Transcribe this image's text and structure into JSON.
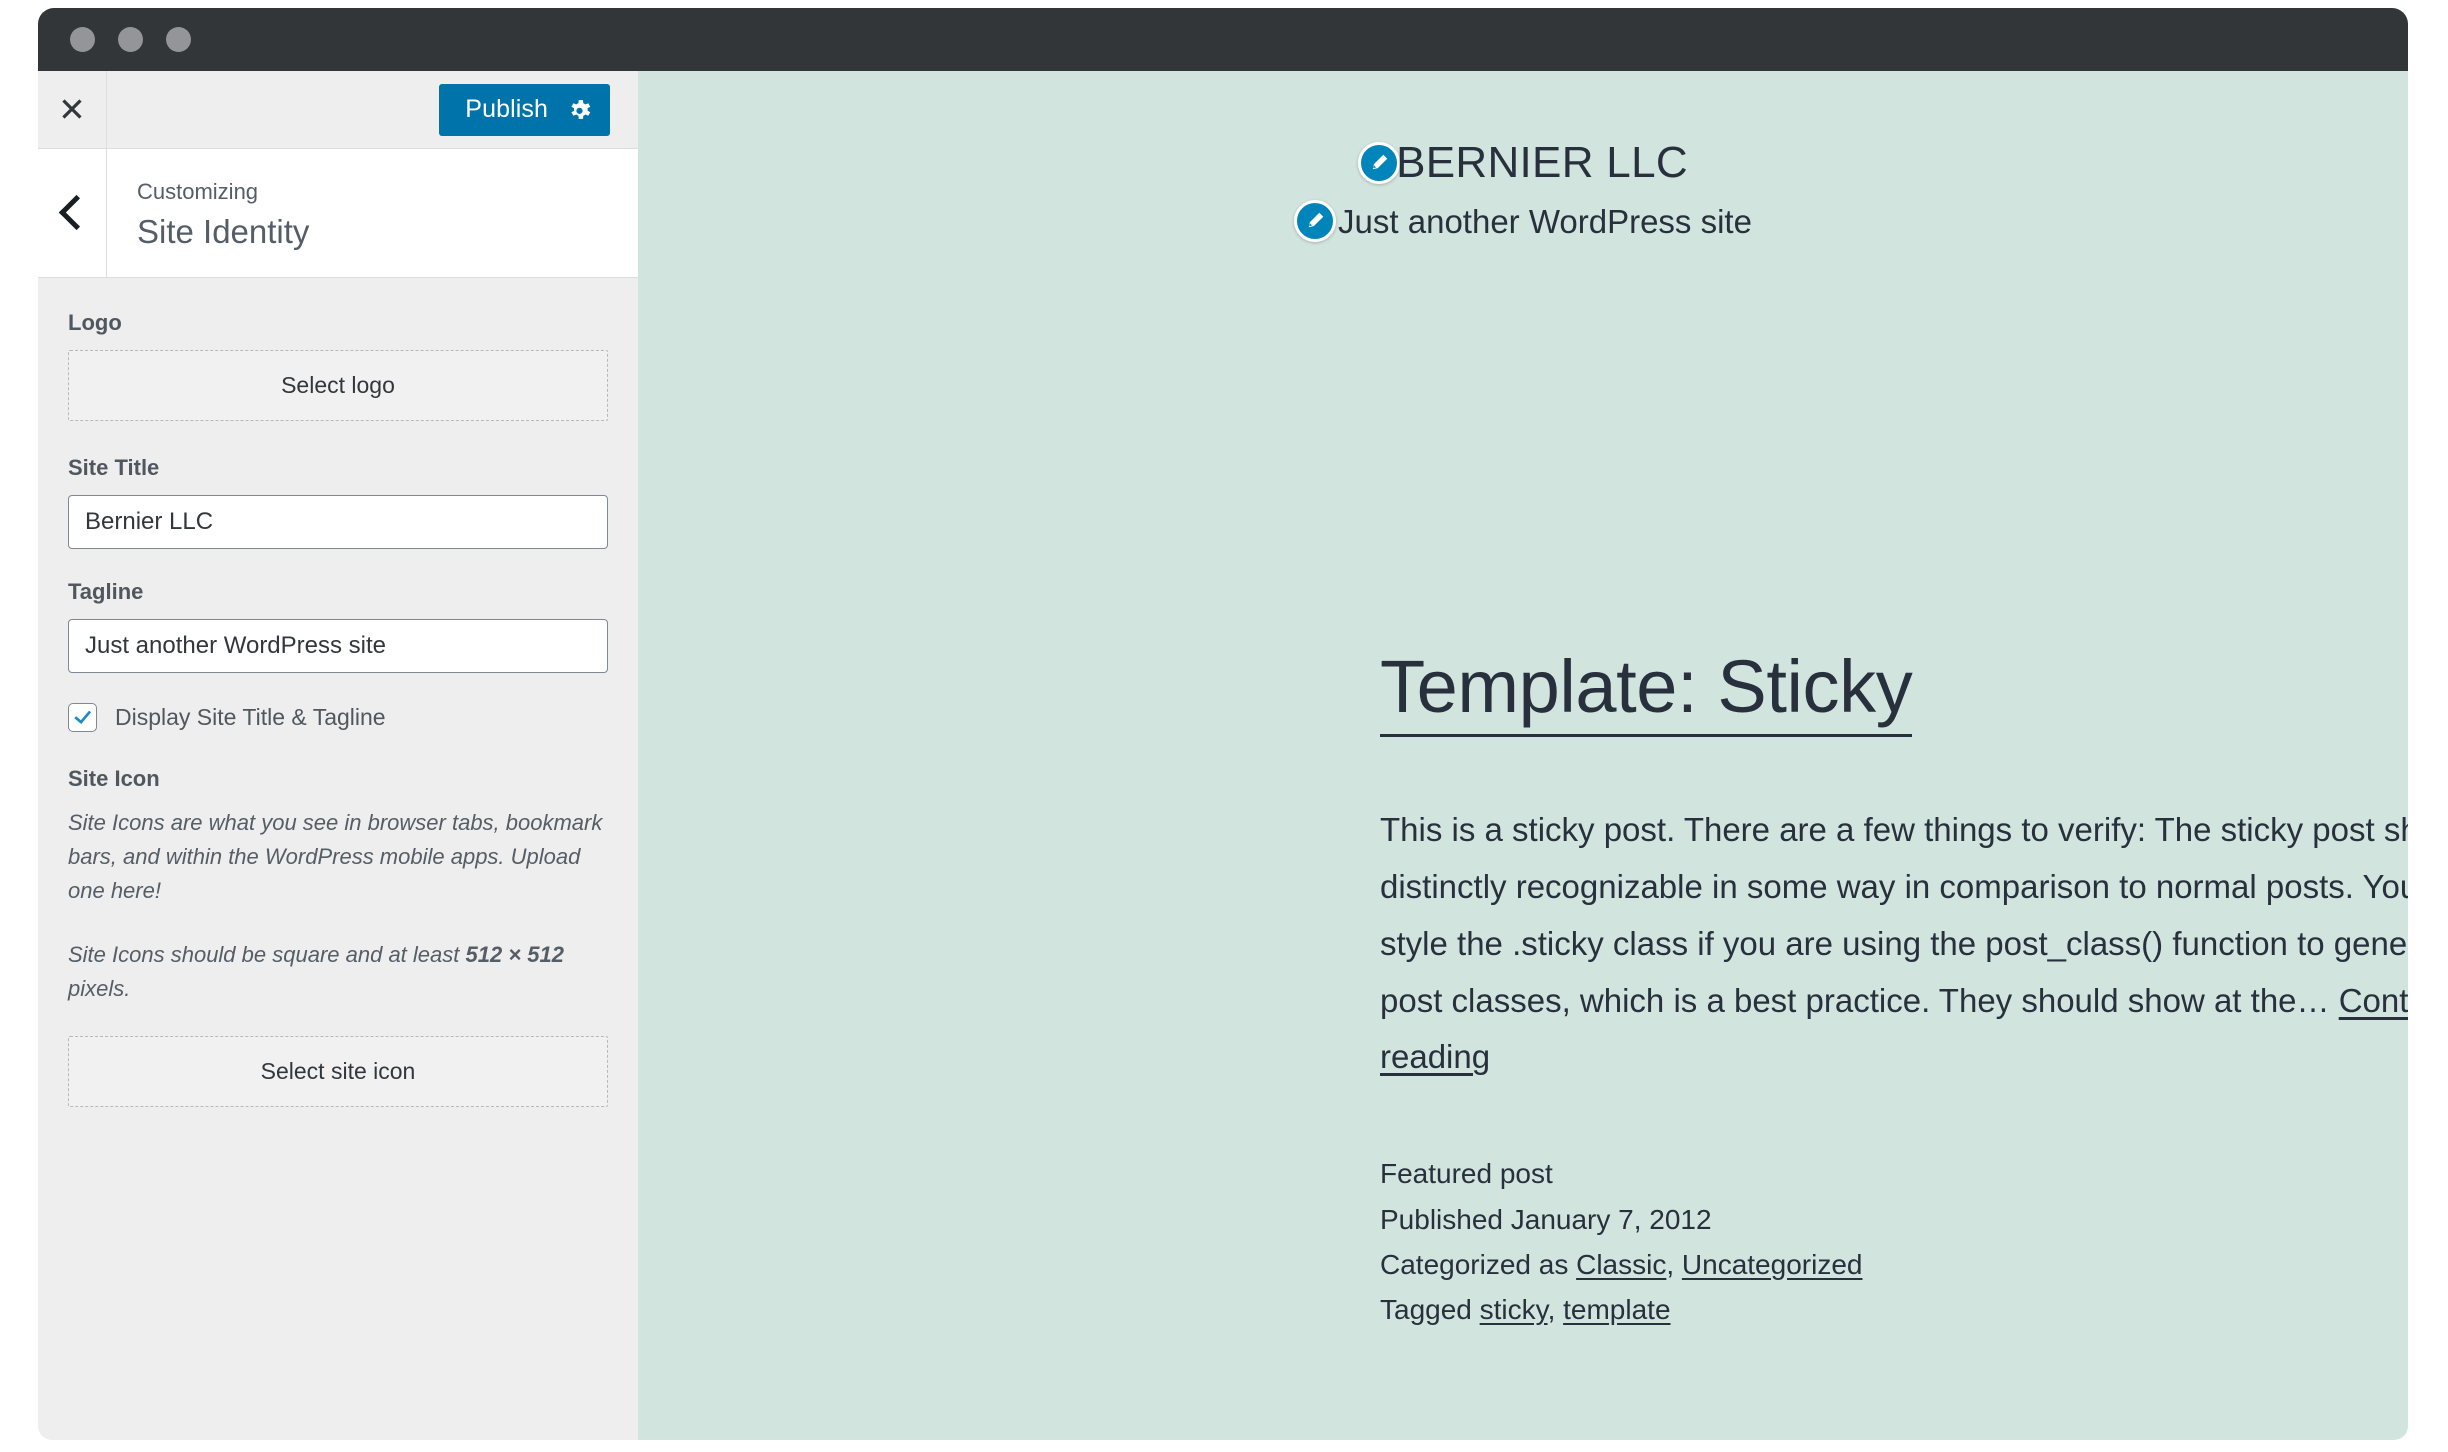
{
  "window": {
    "traffic_lights": [
      "close",
      "minimize",
      "maximize"
    ]
  },
  "customizer": {
    "close_icon": "close-icon",
    "publish_label": "Publish",
    "gear_icon": "gear-icon",
    "back_icon": "chevron-left-icon",
    "breadcrumb": "Customizing",
    "panel_title": "Site Identity",
    "controls": {
      "logo": {
        "label": "Logo",
        "button_label": "Select logo"
      },
      "site_title": {
        "label": "Site Title",
        "value": "Bernier LLC"
      },
      "tagline": {
        "label": "Tagline",
        "value": "Just another WordPress site"
      },
      "display_title_tagline": {
        "label": "Display Site Title & Tagline",
        "checked": true
      },
      "site_icon": {
        "label": "Site Icon",
        "description_1": "Site Icons are what you see in browser tabs, bookmark bars, and within the WordPress mobile apps. Upload one here!",
        "description_2_prefix": "Site Icons should be square and at least ",
        "description_2_bold": "512 × 512",
        "description_2_suffix": " pixels.",
        "button_label": "Select site icon"
      }
    }
  },
  "preview": {
    "site_title": "BERNIER LLC",
    "site_tagline": "Just another WordPress site",
    "edit_icon": "edit-pencil-icon",
    "post": {
      "title": "Template: Sticky",
      "excerpt": "This is a sticky post. There are a few things to verify: The sticky post should be distinctly recognizable in some way in comparison to normal posts. You can style the .sticky class if you are using the post_class() function to generate your post classes, which is a best practice. They should show at the… ",
      "continue_label": "Continue reading",
      "featured_label": "Featured post",
      "published": "Published January 7, 2012",
      "categorized_prefix": "Categorized as ",
      "categories": [
        "Classic",
        "Uncategorized"
      ],
      "tagged_prefix": "Tagged ",
      "tags": [
        "sticky",
        "template"
      ]
    }
  },
  "colors": {
    "accent_blue": "#0073aa",
    "pin_blue": "#0085ba",
    "preview_bg": "#d1e4dd",
    "sidebar_bg": "#eeeeee",
    "titlebar": "#333638",
    "text_dark": "#28303d"
  }
}
